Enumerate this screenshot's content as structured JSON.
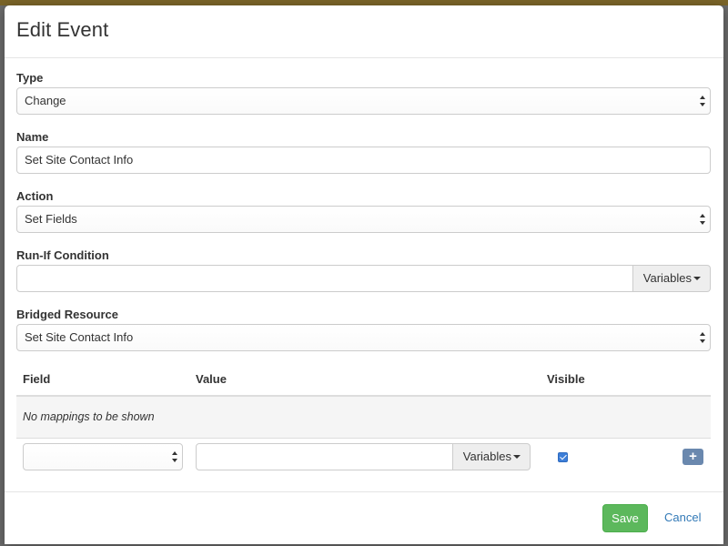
{
  "modal": {
    "title": "Edit Event"
  },
  "fields": {
    "type": {
      "label": "Type",
      "value": "Change"
    },
    "name": {
      "label": "Name",
      "value": "Set Site Contact Info"
    },
    "action": {
      "label": "Action",
      "value": "Set Fields"
    },
    "run_if": {
      "label": "Run-If Condition",
      "value": "",
      "button": "Variables"
    },
    "bridged_resource": {
      "label": "Bridged Resource",
      "value": "Set Site Contact Info"
    }
  },
  "mappings": {
    "columns": [
      "Field",
      "Value",
      "Visible"
    ],
    "empty_text": "No mappings to be shown",
    "new_row": {
      "field_value": "",
      "value_value": "",
      "variables_button": "Variables",
      "visible_checked": true,
      "add_button": "+"
    }
  },
  "footer": {
    "save_label": "Save",
    "cancel_label": "Cancel"
  },
  "colors": {
    "save": "#5cb85c",
    "link": "#337ab7",
    "add_button": "#6a88ae",
    "checkbox": "#3d7ed8"
  }
}
